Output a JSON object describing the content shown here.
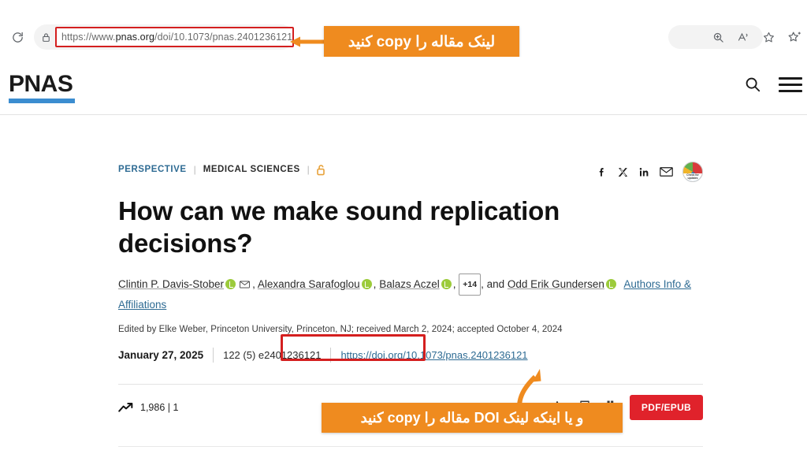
{
  "browser": {
    "reload_icon": "reload-icon",
    "lock_icon": "lock-icon",
    "url_scheme": "https://www.",
    "url_domain": "pnas.org",
    "url_path": "/doi/10.1073/pnas.2401236121",
    "url_full": "https://www.pnas.org/doi/10.1073/pnas.2401236121",
    "toolbar_icons": [
      "zoom-icon",
      "read-aloud-icon",
      "favorite-star-icon",
      "collections-icon"
    ]
  },
  "callouts": {
    "top": {
      "text": "لینک مقاله را copy کنید",
      "color": "#ef8b1f",
      "arrow": "arrow-left-icon"
    },
    "bottom": {
      "text": "و یا اینکه لینک DOI مقاله را copy کنید",
      "color": "#ef8b1f",
      "arrow": "curved-arrow-icon"
    }
  },
  "site_header": {
    "logo_text": "PNAS",
    "logo_rule_color": "#3b8dd0",
    "search_icon": "search-icon",
    "menu_icon": "hamburger-menu-icon"
  },
  "article": {
    "kicker": {
      "type_label": "PERSPECTIVE",
      "separator": "|",
      "subject_label": "MEDICAL SCIENCES",
      "access_icon": "open-access-lock-icon"
    },
    "social_icons": [
      "facebook-icon",
      "x-twitter-icon",
      "linkedin-icon",
      "email-icon",
      "altmetric-badge"
    ],
    "altmetric_label": "Check for updates",
    "title": "How can we make sound replication decisions?",
    "authors": {
      "a1": "Clintin P. Davis-Stober",
      "a2": "Alexandra Sarafoglou",
      "a3": "Balazs Aczel",
      "more_badge": "+14",
      "conjunction": ", and ",
      "a4": "Odd Erik Gundersen",
      "affiliations_link": "Authors Info & Affiliations",
      "sep": ", "
    },
    "edited_line": "Edited by Elke Weber, Princeton University, Princeton, NJ; received March 2, 2024; accepted October 4, 2024",
    "publication": {
      "date": "January 27, 2025",
      "issue": "122 (5) e2401236121",
      "doi_prefix": "https://doi.org",
      "doi_suffix": "/10.1073/pnas.2401236121",
      "highlight_color": "#d41f1f"
    },
    "metrics": {
      "trend_icon": "trending-up-icon",
      "value": "1,986 | 1"
    },
    "actions": {
      "alert_icon": "bell-alert-icon",
      "save_icon": "bookmark-icon",
      "cite_icon": "quote-icon",
      "pdf_label": "PDF/EPUB",
      "pdf_color": "#e0222b"
    }
  }
}
